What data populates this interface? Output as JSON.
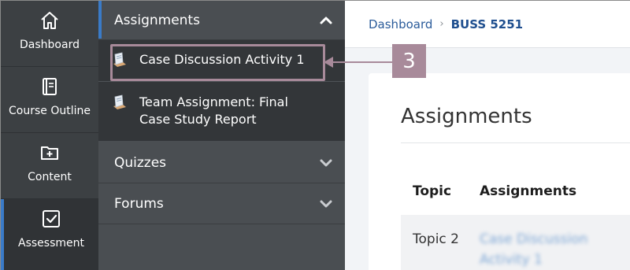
{
  "rail": {
    "items": [
      {
        "label": "Dashboard",
        "icon": "home-icon",
        "active": false
      },
      {
        "label": "Course Outline",
        "icon": "book-icon",
        "active": false
      },
      {
        "label": "Content",
        "icon": "folder-plus-icon",
        "active": false
      },
      {
        "label": "Assessment",
        "icon": "checkbox-icon",
        "active": true
      }
    ]
  },
  "subnav": {
    "sections": [
      {
        "label": "Assignments",
        "expanded": true,
        "items": [
          {
            "label": "Case Discussion Activity 1",
            "icon": "document-icon"
          },
          {
            "label_line1": "Team Assignment: Final",
            "label_line2": "Case Study Report",
            "icon": "document-icon"
          }
        ]
      },
      {
        "label": "Quizzes",
        "expanded": false
      },
      {
        "label": "Forums",
        "expanded": false
      }
    ]
  },
  "callout": {
    "number": "3",
    "color": "#a88a9a"
  },
  "breadcrumb": {
    "home": "Dashboard",
    "separator": "›",
    "current": "BUSS 5251"
  },
  "main": {
    "title": "Assignments",
    "table": {
      "headers": [
        "Topic",
        "Assignments"
      ],
      "rows": [
        {
          "topic": "Topic 2",
          "assignment": "Case Discussion Activity 1"
        }
      ]
    }
  },
  "colors": {
    "accent": "#3a7bc8",
    "rail_bg": "#3c4043",
    "subnav_bg": "#4a4e52"
  }
}
